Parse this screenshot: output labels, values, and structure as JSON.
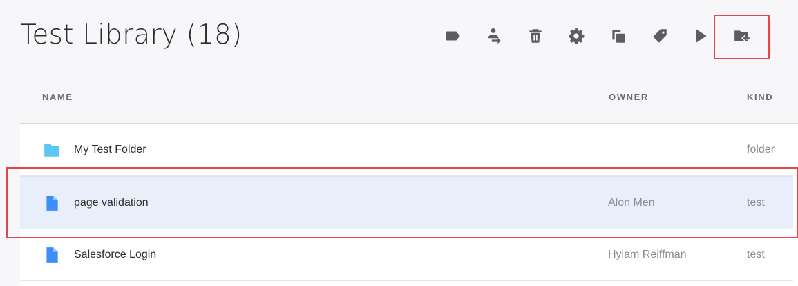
{
  "header": {
    "title": "Test Library (18)"
  },
  "toolbar": {
    "buttons": [
      {
        "icon": "label-icon"
      },
      {
        "icon": "transfer-owner-icon"
      },
      {
        "icon": "trash-icon"
      },
      {
        "icon": "gear-icon"
      },
      {
        "icon": "copy-icon"
      },
      {
        "icon": "tag-icon"
      },
      {
        "icon": "play-icon"
      },
      {
        "icon": "move-to-folder-icon"
      }
    ]
  },
  "columns": {
    "name": "NAME",
    "owner": "OWNER",
    "kind": "KIND"
  },
  "rows": [
    {
      "name": "My Test Folder",
      "owner": "",
      "kind": "folder",
      "icon": "folder-icon"
    },
    {
      "name": "page validation",
      "owner": "Alon Men",
      "kind": "test",
      "icon": "file-icon",
      "selected": true
    },
    {
      "name": "Salesforce Login",
      "owner": "Hyiam Reiffman",
      "kind": "test",
      "icon": "file-icon"
    }
  ],
  "colors": {
    "highlight": "#e2474b",
    "folder": "#5ac8f5",
    "file": "#3d8ef7",
    "selected_row": "#e9eefb"
  }
}
